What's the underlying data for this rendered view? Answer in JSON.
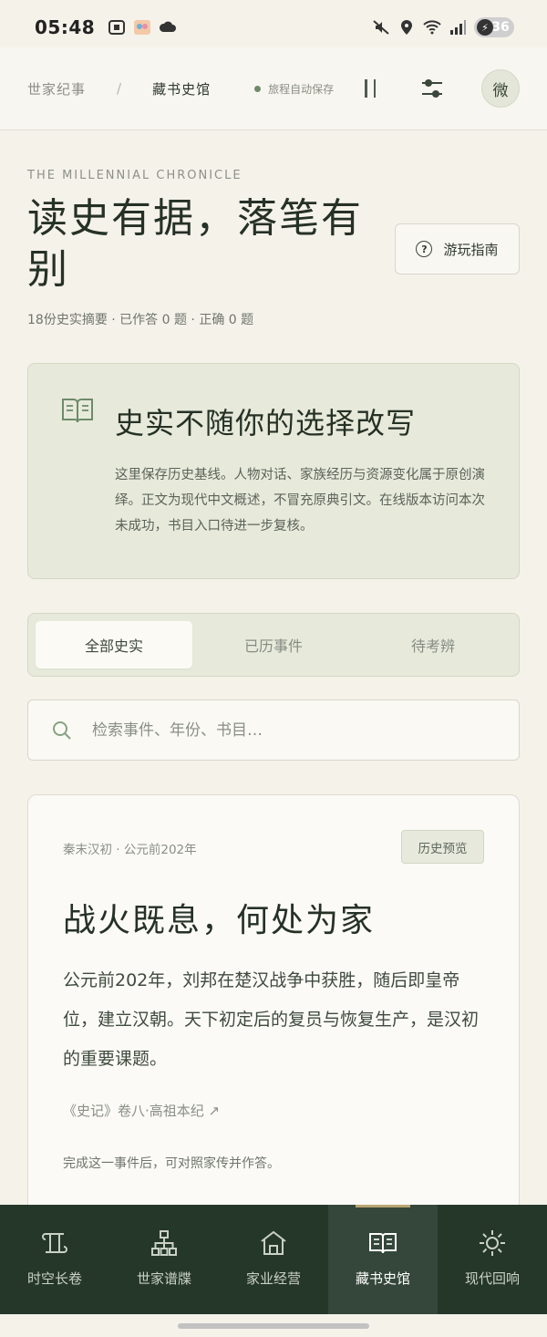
{
  "status": {
    "time": "05:48",
    "battery": "36"
  },
  "nav": {
    "crumb_root": "世家纪事",
    "crumb_sep": "/",
    "crumb_current": "藏书史馆",
    "autosave": "旅程自动保存",
    "avatar": "微"
  },
  "header": {
    "kicker": "THE MILLENNIAL CHRONICLE",
    "title": "读史有据，落笔有别",
    "guide_label": "游玩指南",
    "stats": "18份史实摘要 · 已作答 0 题 · 正确 0 题"
  },
  "notice": {
    "title": "史实不随你的选择改写",
    "body": "这里保存历史基线。人物对话、家族经历与资源变化属于原创演绎。正文为现代中文概述，不冒充原典引文。在线版本访问本次未成功，书目入口待进一步复核。"
  },
  "tabs": [
    {
      "label": "全部史实",
      "active": true
    },
    {
      "label": "已历事件",
      "active": false
    },
    {
      "label": "待考辨",
      "active": false
    }
  ],
  "search": {
    "placeholder": "检索事件、年份、书目…",
    "value": ""
  },
  "event": {
    "meta": "秦末汉初 · 公元前202年",
    "badge": "历史预览",
    "title": "战火既息，何处为家",
    "body": "公元前202年，刘邦在楚汉战争中获胜，随后即皇帝位，建立汉朝。天下初定后的复员与恢复生产，是汉初的重要课题。",
    "source": "《史记》卷八·高祖本纪 ↗",
    "note": "完成这一事件后，可对照家传并作答。"
  },
  "tabbar": [
    {
      "label": "时空长卷",
      "icon": "scroll-icon"
    },
    {
      "label": "世家谱牒",
      "icon": "family-tree-icon"
    },
    {
      "label": "家业经营",
      "icon": "house-icon"
    },
    {
      "label": "藏书史馆",
      "icon": "book-icon",
      "active": true
    },
    {
      "label": "现代回响",
      "icon": "sun-icon"
    }
  ],
  "colors": {
    "accent": "#253729",
    "highlight": "#b9a571",
    "card_green": "#e7eadb"
  }
}
